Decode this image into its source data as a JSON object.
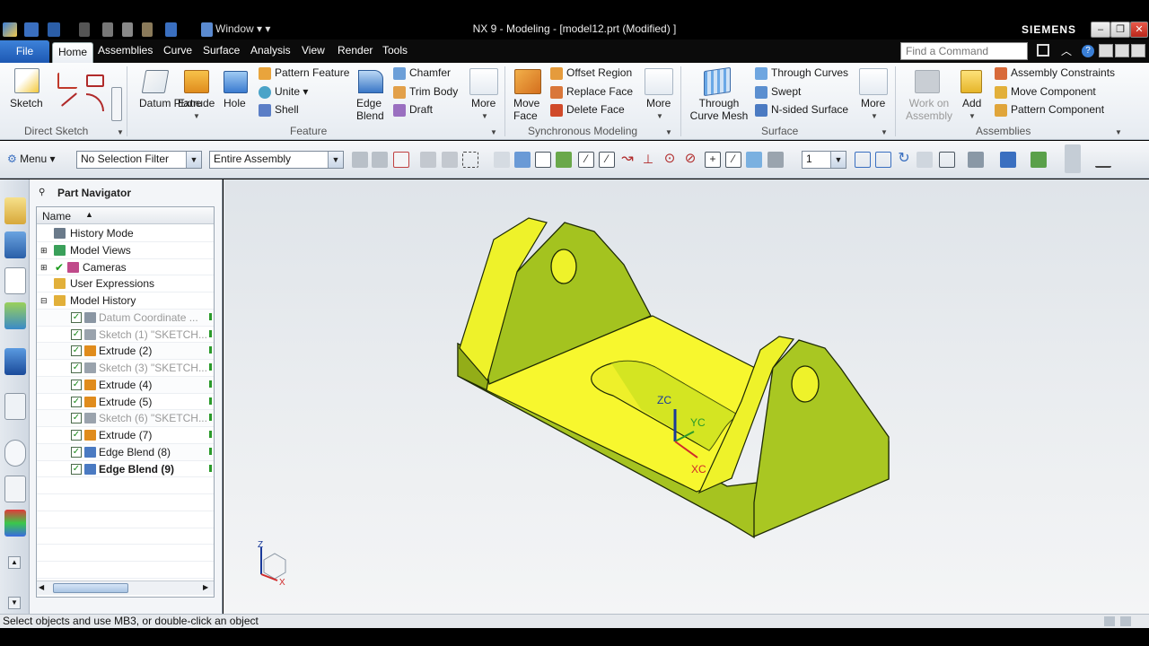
{
  "window": {
    "title": "NX 9 - Modeling - [model12.prt (Modified) ]",
    "brand": "SIEMENS",
    "window_menu_label": "Window"
  },
  "menu_tabs": [
    "File",
    "Home",
    "Assemblies",
    "Curve",
    "Surface",
    "Analysis",
    "View",
    "Render",
    "Tools"
  ],
  "active_tab": "Home",
  "find_command": {
    "placeholder": "Find a Command"
  },
  "ribbon": {
    "direct_sketch": {
      "title": "Direct Sketch",
      "sketch": "Sketch"
    },
    "feature": {
      "title": "Feature",
      "datum_plane": "Datum Plane",
      "extrude": "Extrude",
      "hole": "Hole",
      "pattern_feature": "Pattern Feature",
      "unite": "Unite",
      "shell": "Shell",
      "edge_blend": "Edge Blend",
      "chamfer": "Chamfer",
      "trim_body": "Trim Body",
      "draft": "Draft",
      "more": "More"
    },
    "synchronous": {
      "title": "Synchronous Modeling",
      "move_face": "Move Face",
      "offset_region": "Offset Region",
      "replace_face": "Replace Face",
      "delete_face": "Delete Face",
      "more": "More"
    },
    "surface": {
      "title": "Surface",
      "through_curve_mesh": "Through Curve Mesh",
      "through_curves": "Through Curves",
      "swept": "Swept",
      "n_sided_surface": "N-sided Surface",
      "more": "More"
    },
    "assemblies": {
      "title": "Assemblies",
      "work_on_assembly": "Work on Assembly",
      "add": "Add",
      "assembly_constraints": "Assembly Constraints",
      "move_component": "Move Component",
      "pattern_component": "Pattern Component"
    }
  },
  "toolbar": {
    "menu": "Menu",
    "selection_filter": "No Selection Filter",
    "scope": "Entire Assembly",
    "layer": "1"
  },
  "navigator": {
    "title": "Part Navigator",
    "column_name": "Name",
    "items": [
      {
        "label": "History Mode",
        "indent": 0,
        "state": "normal"
      },
      {
        "label": "Model Views",
        "indent": 0,
        "state": "normal"
      },
      {
        "label": "Cameras",
        "indent": 0,
        "state": "normal"
      },
      {
        "label": "User Expressions",
        "indent": 0,
        "state": "normal"
      },
      {
        "label": "Model History",
        "indent": 0,
        "state": "normal"
      },
      {
        "label": "Datum Coordinate ...",
        "indent": 1,
        "state": "gray"
      },
      {
        "label": "Sketch (1) \"SKETCH...",
        "indent": 1,
        "state": "gray"
      },
      {
        "label": "Extrude (2)",
        "indent": 1,
        "state": "normal"
      },
      {
        "label": "Sketch (3) \"SKETCH...",
        "indent": 1,
        "state": "gray"
      },
      {
        "label": "Extrude (4)",
        "indent": 1,
        "state": "normal"
      },
      {
        "label": "Extrude (5)",
        "indent": 1,
        "state": "normal"
      },
      {
        "label": "Sketch (6) \"SKETCH...",
        "indent": 1,
        "state": "gray"
      },
      {
        "label": "Extrude (7)",
        "indent": 1,
        "state": "normal"
      },
      {
        "label": "Edge Blend (8)",
        "indent": 1,
        "state": "normal"
      },
      {
        "label": "Edge Blend (9)",
        "indent": 1,
        "state": "bold"
      }
    ]
  },
  "viewport": {
    "axis_labels": {
      "zc": "ZC",
      "yc": "YC",
      "xc": "XC"
    },
    "triad_labels": {
      "z": "Z",
      "x": "X"
    },
    "model_color": "#d8f03a"
  },
  "status": {
    "message": "Select objects and use MB3, or double-click an object"
  }
}
